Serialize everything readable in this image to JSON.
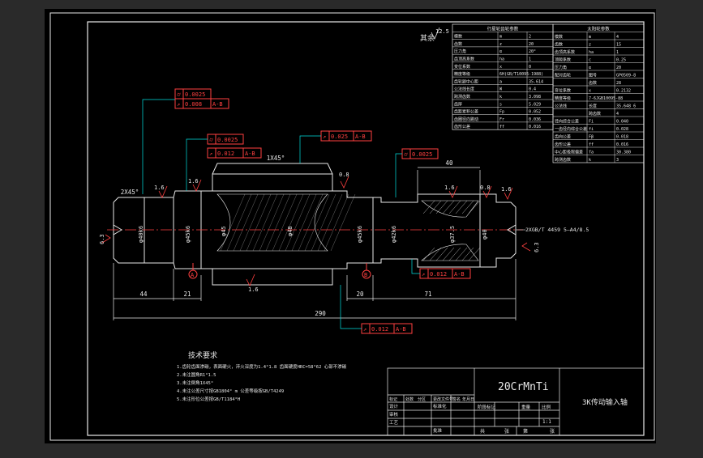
{
  "drawing": {
    "material": "20CrMnTi",
    "part_name": "3K传动输入轴",
    "scale": "1:1",
    "roughness_all": "12.5",
    "roughness_all_label": "其余",
    "total_length": "290",
    "dims": {
      "d44": "44",
      "d21": "21",
      "d20": "20",
      "d71": "71",
      "d40": "40",
      "chamfer_left": "2X45°",
      "chamfer_gear": "1X45°"
    },
    "diameters": {
      "phi_left": "φ40k6",
      "phi_bearing_l": "φ45k6",
      "phi45": "φ45",
      "phi48": "φ48",
      "phi_bearing_r": "φ45k6",
      "phi42": "φ42k6",
      "phi37": "φ37.5",
      "phi40": "φ40"
    },
    "roughness": {
      "r1": "1.6",
      "r2": "1.6",
      "r3": "0.8",
      "r4": "1.6",
      "r5": "0.8",
      "r6": "1.6",
      "r7": "6.3",
      "r8": "6.3",
      "r9": "1.6"
    },
    "datums": {
      "a": "A",
      "b": "B"
    },
    "gdt": {
      "f1_a": "0.0025",
      "f1_b": "0.008",
      "f1_ref": "A-B",
      "f2_a": "0.0025",
      "f2_b": "0.012",
      "f2_ref": "A-B",
      "f3": "0.025",
      "f3_ref": "A-B",
      "f4": "0.0025",
      "f5": "0.012",
      "f5_ref": "A-B",
      "f6": "0.012",
      "f6_ref": "A-B",
      "sym_cyl": "⌭",
      "sym_run": "↗"
    },
    "center_hole": "2XGB/T 4459 5—A4/8.5",
    "tech_title": "技术要求",
    "tech_lines": [
      "1.齿轮齿面渗碳，表面硬火，淬火深度为1.4°1.8 齿面硬度HRC=58°62 心部不渗碳",
      "2.未注圆角R1°1.5",
      "3.未注倒角1X45°",
      "4.未注公差尺寸按GB1804° m 公差等级按GB/T4249",
      "5.未注形位公差按GB/T1184°H"
    ]
  },
  "gear_table_1": {
    "title": "行星轮齿轮参数",
    "rows": [
      [
        "模数",
        "m",
        "2"
      ],
      [
        "齿数",
        "z",
        "20"
      ],
      [
        "压力角",
        "α",
        "20°"
      ],
      [
        "齿顶高系数",
        "ha",
        "1"
      ],
      [
        "变位系数",
        "x",
        "0"
      ],
      [
        "精度等级",
        "6H(GB/T10095-1988)",
        ""
      ],
      [
        "齿轮副中心距",
        "a",
        "35.614"
      ],
      [
        "公法线长度",
        "W",
        "0.4"
      ],
      [
        "跨测齿数",
        "k",
        "3.098"
      ],
      [
        "齿厚",
        "s",
        "5.029"
      ],
      [
        "齿距累积公差",
        "Fp",
        "0.052"
      ],
      [
        "齿圈径向跳动",
        "Fr",
        "0.036"
      ],
      [
        "齿形公差",
        "ff",
        "0.016"
      ]
    ]
  },
  "gear_table_2": {
    "title": "太阳轮参数",
    "rows": [
      [
        "模数",
        "m",
        "4"
      ],
      [
        "齿数",
        "z",
        "15"
      ],
      [
        "齿顶高系数",
        "ha",
        "1"
      ],
      [
        "顶隙系数",
        "c",
        "0.25"
      ],
      [
        "压力角",
        "α",
        "20"
      ],
      [
        "配对齿轮",
        "图号",
        "GP0509-8"
      ],
      [
        "",
        "齿数",
        "28"
      ],
      [
        "变位系数",
        "x",
        "0.2132"
      ],
      [
        "精度等级",
        "7-6JGB10095-88",
        ""
      ],
      [
        "公法线",
        "长度",
        "35.648 6"
      ],
      [
        "",
        "跨齿数",
        "4"
      ],
      [
        "径向综合公差",
        "Fi",
        "0.040"
      ],
      [
        "一齿径向综合公差",
        "fi",
        "0.028"
      ],
      [
        "齿向公差",
        "Fβ",
        "0.018"
      ],
      [
        "齿形公差",
        "ff",
        "0.016"
      ],
      [
        "中心距极限偏差",
        "fa",
        "30.380"
      ],
      [
        "跨测齿数",
        "k",
        "3"
      ]
    ]
  },
  "title_block": {
    "labels": [
      "标记",
      "处数",
      "分区",
      "更改文件号",
      "签名",
      "年月日"
    ],
    "roles": [
      "设计",
      "标准化",
      "审核",
      "工艺",
      "批准"
    ],
    "stage_labels": [
      "阶段标记",
      "重量",
      "比例"
    ],
    "sheet_labels": [
      "共",
      "张",
      "第",
      "张"
    ]
  }
}
